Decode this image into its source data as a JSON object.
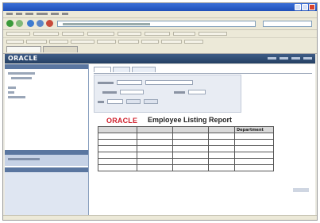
{
  "window": {
    "title": "",
    "menu": [
      "",
      "",
      "",
      "",
      "",
      ""
    ]
  },
  "address_bar": {
    "url": ""
  },
  "search": {
    "placeholder": ""
  },
  "browser_tabs": [
    {
      "label": ""
    },
    {
      "label": ""
    }
  ],
  "app": {
    "brand": "ORACLE",
    "product": "",
    "links": [
      "",
      "",
      "",
      ""
    ]
  },
  "sidebar": {
    "items": [
      "",
      "",
      "",
      "",
      "",
      ""
    ]
  },
  "content_tabs": [
    {
      "label": ""
    },
    {
      "label": ""
    },
    {
      "label": ""
    }
  ],
  "report": {
    "logo": "ORACLE",
    "title": "Employee Listing Report",
    "columns": [
      "",
      "",
      "",
      "",
      "Department"
    ],
    "rows": [
      [
        "",
        "",
        "",
        "",
        ""
      ],
      [
        "",
        "",
        "",
        "",
        ""
      ],
      [
        "",
        "",
        "",
        "",
        ""
      ],
      [
        "",
        "",
        "",
        "",
        ""
      ],
      [
        "",
        "",
        "",
        "",
        ""
      ],
      [
        "",
        "",
        "",
        "",
        ""
      ]
    ],
    "total_label": "",
    "total_value": ""
  },
  "colors": {
    "oracle_red": "#d0202c",
    "app_bar": "#2f4a72",
    "params_panel": "#e8ecf3"
  },
  "icons": [
    "back-icon",
    "forward-icon",
    "refresh-icon",
    "home-icon",
    "search-icon",
    "close-icon"
  ]
}
